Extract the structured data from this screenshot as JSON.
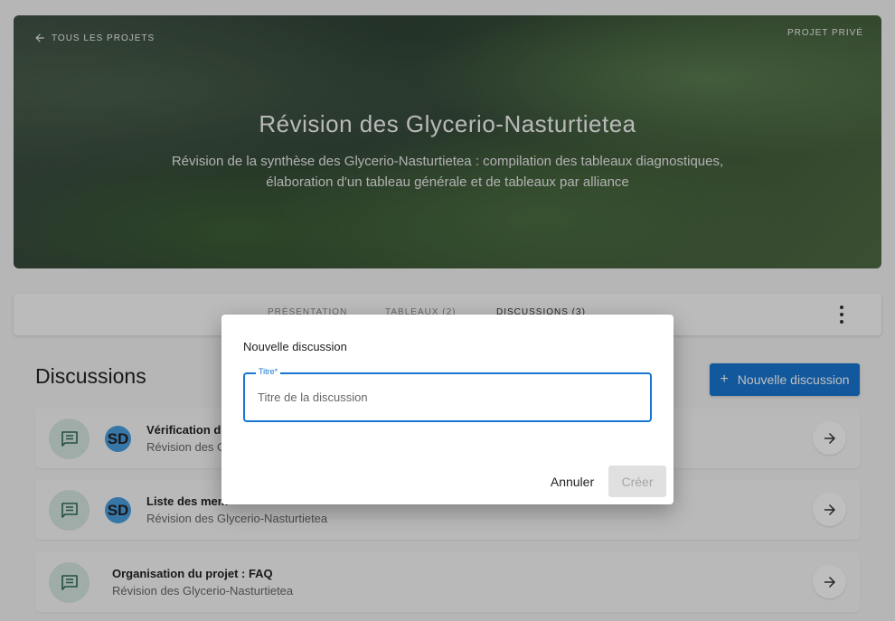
{
  "hero": {
    "back_label": "TOUS LES PROJETS",
    "visibility": "PROJET PRIVÉ",
    "title": "Révision des Glycerio-Nasturtietea",
    "description": "Révision de la synthèse des Glycerio-Nasturtietea : compilation des tableaux diagnostiques, élaboration d'un tableau générale et de tableaux par alliance"
  },
  "tabs": [
    {
      "label": "PRÉSENTATION"
    },
    {
      "label": "TABLEAUX (2)"
    },
    {
      "label": "DISCUSSIONS (3)"
    }
  ],
  "discussions": {
    "heading": "Discussions",
    "new_button": "Nouvelle discussion",
    "items": [
      {
        "title": "Vérification de",
        "subtitle": "Révision des G",
        "initials": "SD"
      },
      {
        "title": "Liste des mem",
        "subtitle": "Révision des Glycerio-Nasturtietea",
        "initials": "SD"
      },
      {
        "title": "Organisation du projet : FAQ",
        "subtitle": "Révision des Glycerio-Nasturtietea"
      }
    ]
  },
  "dialog": {
    "title": "Nouvelle discussion",
    "field_label": "Titre*",
    "field_value": "",
    "field_placeholder": "Titre de la discussion",
    "cancel": "Annuler",
    "create": "Créer"
  },
  "colors": {
    "accent": "#1976d2",
    "avatar": "#4a9fe0",
    "chat_bg": "#d5e6df",
    "chat_icon": "#2f6b57"
  }
}
